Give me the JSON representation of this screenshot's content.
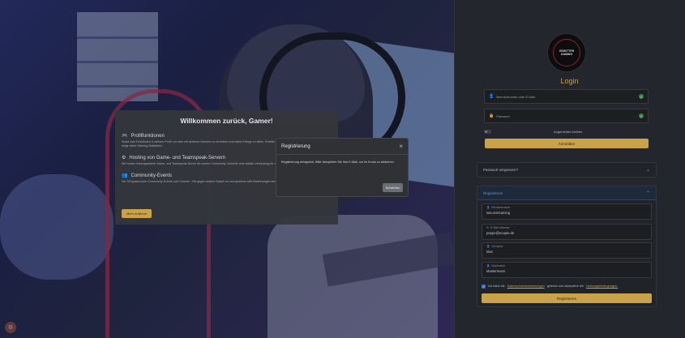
{
  "welcome": {
    "title": "Willkommen zurück, Gamer!",
    "sections": [
      {
        "icon": "gamepad-icon",
        "glyph": "🎮",
        "title": "Profilfunktionen",
        "text": "Nutze tolle Funktionen in deinem Profil, um dich mit anderen Gamern zu vernetzen und deine Erfolge zu teilen. Erstelle Beiträge, schreibe Kommentare an und zeige deine Gaming-Statistiken."
      },
      {
        "icon": "server-icon",
        "glyph": "⚙",
        "title": "Hosting von Game- und Teamspeak-Servern",
        "text": "Wir hosten leistungsstarke Game- und Teamspeak-Server für unsere Community. Genieße eine stabile Verbindung für dein Spielvergnügen."
      },
      {
        "icon": "group-icon",
        "glyph": "👥",
        "title": "Community-Events",
        "text": "Sei Teil spannender Community-Events und Turniere. Tritt gegen andere Spieler an und gewinne tolle Belohnungen auf dich!"
      }
    ],
    "more_button": "Mehr erfahren"
  },
  "modal": {
    "title": "Registrierung",
    "message": "Registrierung erfolgreich, Bitte überprüfen Sie Ihre E-Mail, um Ihr Konto zu aktivieren.",
    "close_button": "Schließen"
  },
  "login": {
    "logo_text": "GEWITTER GAMING",
    "title": "Login",
    "username_placeholder": "Benutzername oder E-Mail",
    "password_placeholder": "Passwort",
    "remember_label": "Angemeldet bleiben",
    "login_button": "Anmelden",
    "forgot_label": "Passwort vergessen?"
  },
  "register": {
    "header": "Registrieren",
    "fields": [
      {
        "label": "Benutzername",
        "value": "weLoveGaming"
      },
      {
        "label": "E-Mail Adresse",
        "value": "peppe@ecapto.de"
      },
      {
        "label": "Vorname",
        "value": "Max"
      },
      {
        "label": "Nachname",
        "value": "Mustermann"
      }
    ],
    "terms_prefix": "Ich habe die",
    "terms_link": "Datenschutzbestimmungen",
    "terms_middle": "gelesen und akzeptiere die",
    "terms_link2": "Nutzungsbedingungen.",
    "submit_button": "Registrieren"
  },
  "colors": {
    "accent": "#c9a24a",
    "success": "#2f8a4a",
    "link_blue": "#6a90c8"
  }
}
